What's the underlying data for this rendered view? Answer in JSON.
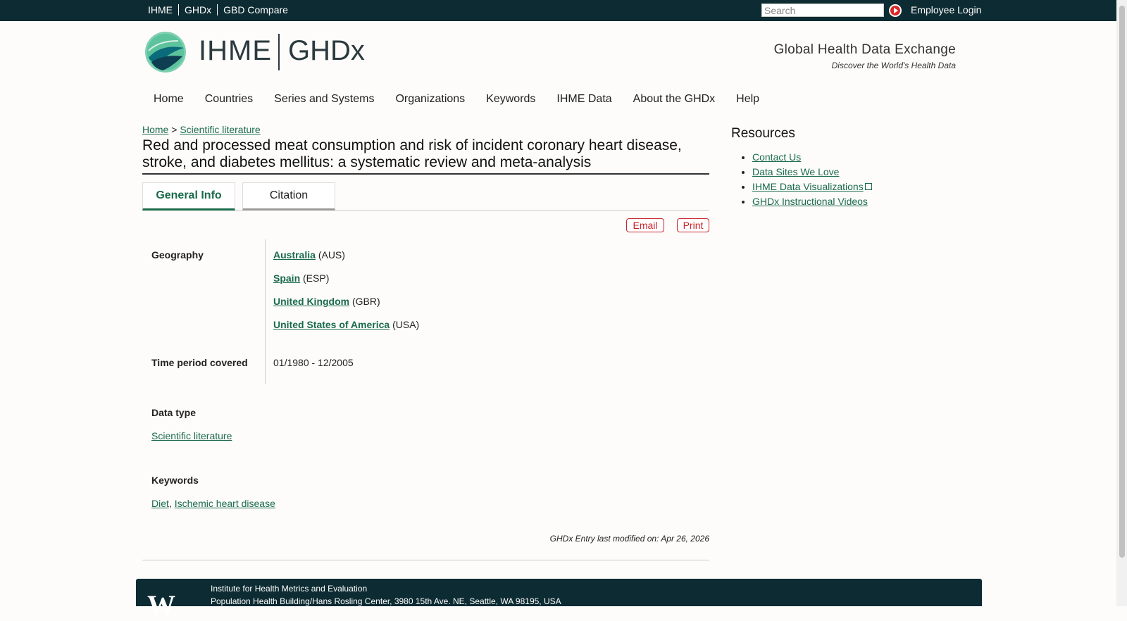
{
  "topbar": {
    "links": [
      "IHME",
      "GHDx",
      "GBD Compare"
    ],
    "search_placeholder": "Search",
    "employee_login": "Employee Login"
  },
  "header": {
    "logo_ihme": "IHME",
    "logo_ghdx": "GHDx",
    "tagline_title": "Global Health Data Exchange",
    "tagline_sub": "Discover the World's Health Data"
  },
  "nav": {
    "items": [
      "Home",
      "Countries",
      "Series and Systems",
      "Organizations",
      "Keywords",
      "IHME Data",
      "About the GHDx",
      "Help"
    ]
  },
  "breadcrumb": {
    "home": "Home",
    "sep": ">",
    "current": "Scientific literature"
  },
  "page": {
    "title": "Red and processed meat consumption and risk of incident coronary heart disease, stroke, and diabetes mellitus: a systematic review and meta-analysis"
  },
  "tabs": {
    "general": "General Info",
    "citation": "Citation"
  },
  "actions": {
    "email": "Email",
    "print": "Print"
  },
  "info": {
    "geography_label": "Geography",
    "geography": [
      {
        "name": "Australia",
        "code": "(AUS)"
      },
      {
        "name": "Spain",
        "code": "(ESP)"
      },
      {
        "name": "United Kingdom",
        "code": "(GBR)"
      },
      {
        "name": "United States of America",
        "code": "(USA)"
      }
    ],
    "time_label": "Time period covered",
    "time_value": "01/1980 - 12/2005",
    "data_type_label": "Data type",
    "data_type_value": "Scientific literature",
    "keywords_label": "Keywords",
    "keywords": [
      "Diet",
      "Ischemic heart disease"
    ],
    "keywords_sep": ", ",
    "modified": "GHDx Entry last modified on: Apr 26, 2026"
  },
  "sidebar": {
    "title": "Resources",
    "items": [
      "Contact Us",
      "Data Sites We Love",
      "IHME Data Visualizations",
      "GHDx Instructional Videos"
    ]
  },
  "footer": {
    "uw_logo": "W",
    "line1": "Institute for Health Metrics and Evaluation",
    "line2": "Population Health Building/Hans Rosling Center, 3980 15th Ave. NE, Seattle, WA 98195, USA"
  },
  "colors": {
    "topbar": "#0d2b32",
    "link": "#1a6b4a",
    "action_red": "#c9252b"
  }
}
